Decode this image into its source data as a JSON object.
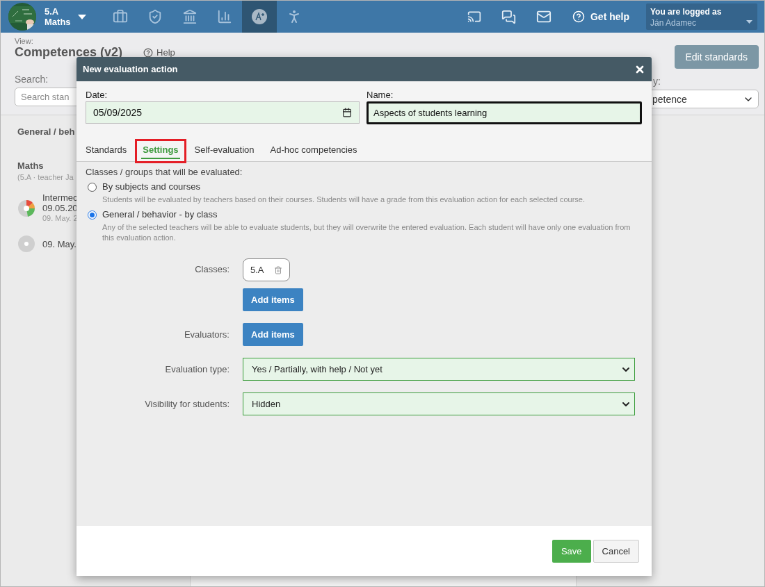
{
  "nav": {
    "class_name": "5.A",
    "subject": "Maths",
    "modules": [
      {
        "kind": "briefcase",
        "selected": false
      },
      {
        "kind": "shield",
        "selected": false
      },
      {
        "kind": "building",
        "selected": false
      },
      {
        "kind": "chart",
        "selected": false
      },
      {
        "kind": "grade",
        "selected": true
      },
      {
        "kind": "walkers",
        "selected": false
      }
    ],
    "help": "Get help",
    "user_label": "You are logged as",
    "user_name": "Ján Adamec"
  },
  "page": {
    "view_label": "View:",
    "view_title": "Competences (v2)",
    "help": "Help",
    "search_label": "Search:",
    "search_placeholder": "Search stan",
    "edit_button": "Edit standards",
    "sort_label": "y:",
    "sort_value": "petence",
    "groups": [
      {
        "title": "General / beh"
      },
      {
        "title": "Maths",
        "subtitle": "(5.A · teacher Ja",
        "items": [
          {
            "kind": "pie",
            "title": "Intermec",
            "date": "09.05.20",
            "note": "09. May. 2"
          },
          {
            "kind": "dot",
            "title": "09. May."
          }
        ]
      }
    ]
  },
  "modal": {
    "title": "New evaluation action",
    "date_label": "Date:",
    "date_value": "05/09/2025",
    "name_label": "Name:",
    "name_value": "Aspects of students learning",
    "tabs": [
      {
        "label": "Standards",
        "selected": false,
        "highlighted": false
      },
      {
        "label": "Settings",
        "selected": true,
        "highlighted": true
      },
      {
        "label": "Self-evaluation",
        "selected": false,
        "highlighted": false
      },
      {
        "label": "Ad-hoc competencies",
        "selected": false,
        "highlighted": false
      }
    ],
    "section_label": "Classes / groups that will be evaluated:",
    "options": [
      {
        "label": "By subjects and courses",
        "description": "Students will be evaluated by teachers based on their courses. Students will have a grade from this evaluation action for each selected course.",
        "selected": false
      },
      {
        "label": "General / behavior - by class",
        "description": "Any of the selected teachers will be able to evaluate students, but they will overwrite the entered evaluation. Each student will have only one evaluation from this evaluation action.",
        "selected": true
      }
    ],
    "classes_label": "Classes:",
    "class_chips": [
      "5.A"
    ],
    "classes_add": "Add items",
    "evaluators_label": "Evaluators:",
    "evaluators_add": "Add items",
    "eval_type_label": "Evaluation type:",
    "eval_type_value": "Yes / Partially, with help / Not yet",
    "visibility_label": "Visibility for students:",
    "visibility_value": "Hidden",
    "save": "Save",
    "cancel": "Cancel"
  }
}
